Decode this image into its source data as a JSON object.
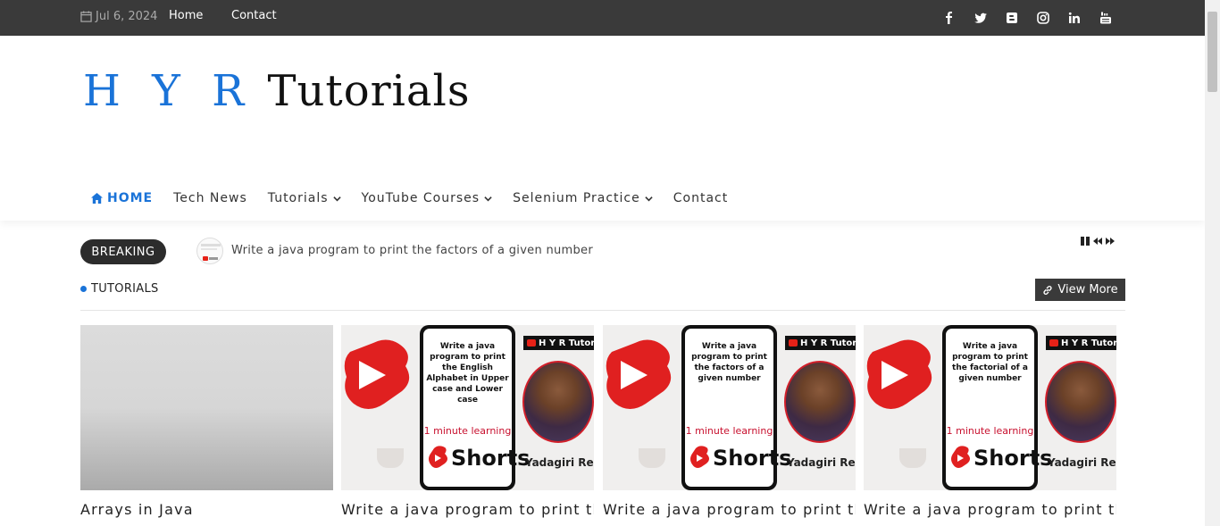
{
  "topbar": {
    "date": "Jul 6, 2024",
    "links": [
      "Home",
      "Contact"
    ],
    "social": [
      "facebook-icon",
      "twitter-icon",
      "blogger-icon",
      "instagram-icon",
      "linkedin-icon",
      "youtube-icon"
    ],
    "bg_color": "#3a3a3a"
  },
  "logo": {
    "part1": "H Y R",
    "part2": "Tutorials",
    "accent": "#1a73d8"
  },
  "nav": {
    "home": "HOME",
    "items": [
      "Tech News",
      "Tutorials",
      "YouTube Courses",
      "Selenium Practice",
      "Contact"
    ]
  },
  "breaking": {
    "label": "BREAKING",
    "text": "Write a java program to print the factors of a given number"
  },
  "section": {
    "title": "TUTORIALS",
    "view_more": "View More"
  },
  "cards": [
    {
      "title": "Arrays in Java"
    },
    {
      "title": "Write a java program to print the English",
      "thumb_text": "Write a java program to print the English Alphabet in Upper case and Lower case",
      "learn": "1 minute learning",
      "shorts": "Shorts",
      "channel": "H Y R Tutorials",
      "author": "Yadagiri Reddy"
    },
    {
      "title": "Write a java program to print the factors",
      "thumb_text": "Write a java program to print the factors of a given number",
      "learn": "1 minute learning",
      "shorts": "Shorts",
      "channel": "H Y R Tutorials",
      "author": "Yadagiri Reddy"
    },
    {
      "title": "Write a java program to print the factorial",
      "thumb_text": "Write a java program to print the factorial of a given number",
      "learn": "1 minute learning",
      "shorts": "Shorts",
      "channel": "H Y R Tutorials",
      "author": "Yadagiri Reddy"
    }
  ]
}
